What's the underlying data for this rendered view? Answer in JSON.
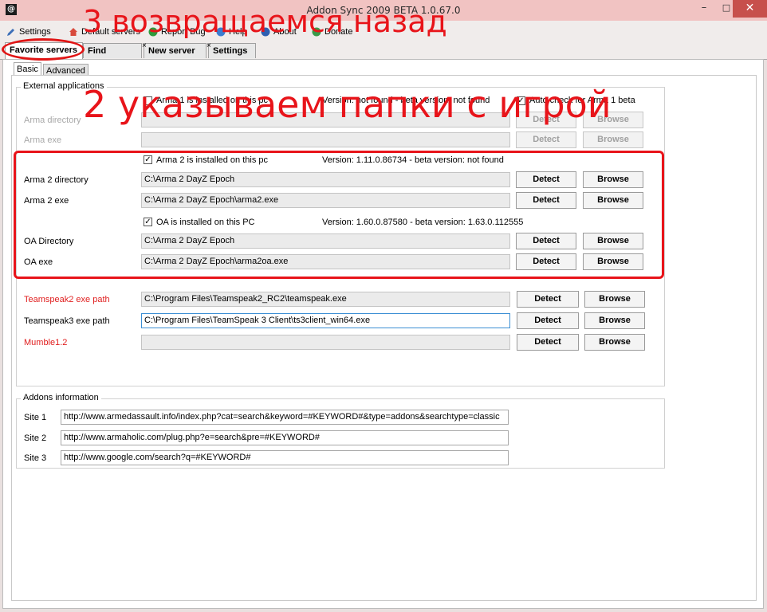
{
  "window": {
    "title": "Addon Sync 2009 BETA 1.0.67.0",
    "icon": "@",
    "minimize": "–",
    "maximize": "□",
    "close": "✕"
  },
  "menu": {
    "settings": "Settings",
    "default_servers": "Default servers",
    "report_bug": "Report Bug",
    "help": "Help",
    "about": "About",
    "donate": "Donate"
  },
  "tabs": {
    "favorite": "Favorite servers",
    "find": "Find servers",
    "new_server": "New server",
    "settings": "Settings"
  },
  "subtabs": {
    "basic": "Basic",
    "advanced": "Advanced"
  },
  "external": {
    "title": "External applications",
    "arma1": {
      "check_label": "Arma 1 is installed on this pc",
      "version": "Version: not found - beta version: not found",
      "autocheck": "Auto check for Arma 1 beta",
      "dir_label": "Arma directory",
      "exe_label": "Arma exe",
      "dir_value": "",
      "exe_value": ""
    },
    "arma2": {
      "check_label": "Arma 2 is installed on this pc",
      "version": "Version: 1.11.0.86734 - beta version: not found",
      "dir_label": "Arma 2 directory",
      "exe_label": "Arma 2 exe",
      "dir_value": "C:\\Arma 2 DayZ Epoch",
      "exe_value": "C:\\Arma 2 DayZ Epoch\\arma2.exe"
    },
    "oa": {
      "check_label": "OA is installed on this PC",
      "version": "Version: 1.60.0.87580 - beta version: 1.63.0.112555",
      "dir_label": "OA Directory",
      "exe_label": "OA exe",
      "dir_value": "C:\\Arma 2 DayZ Epoch",
      "exe_value": "C:\\Arma 2 DayZ Epoch\\arma2oa.exe"
    },
    "ts2": {
      "label": "Teamspeak2 exe path",
      "value": "C:\\Program Files\\Teamspeak2_RC2\\teamspeak.exe"
    },
    "ts3": {
      "label": "Teamspeak3 exe path",
      "value": "C:\\Program Files\\TeamSpeak 3 Client\\ts3client_win64.exe"
    },
    "mumble": {
      "label": "Mumble1.2",
      "value": ""
    },
    "detect": "Detect",
    "browse": "Browse"
  },
  "addons": {
    "title": "Addons information",
    "sites": [
      {
        "label": "Site 1",
        "value": "http://www.armedassault.info/index.php?cat=search&keyword=#KEYWORD#&type=addons&searchtype=classic"
      },
      {
        "label": "Site 2",
        "value": "http://www.armaholic.com/plug.php?e=search&pre=#KEYWORD#"
      },
      {
        "label": "Site 3",
        "value": "http://www.google.com/search?q=#KEYWORD#"
      }
    ]
  },
  "annotations": {
    "step3": "3 возвращаемся назад",
    "step2": "2 указываем папки с игрой"
  },
  "colors": {
    "annotation_red": "#e8141a",
    "title_bar": "#f1c3c2",
    "close_button": "#c7504c",
    "required_label": "#e02020"
  }
}
